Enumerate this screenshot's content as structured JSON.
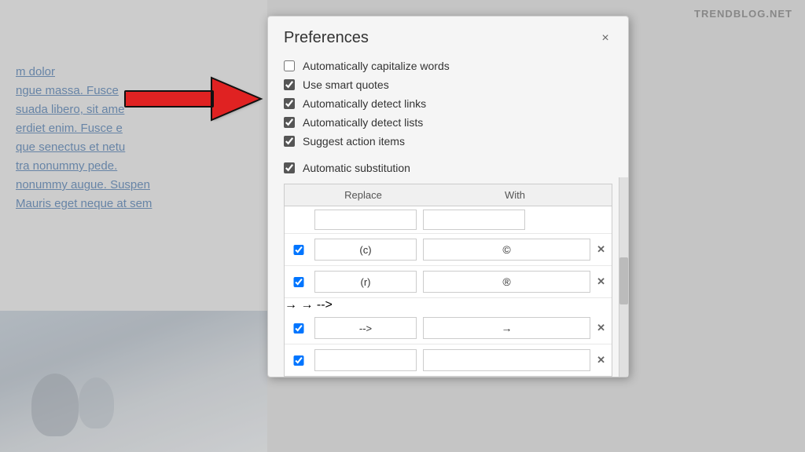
{
  "watermark": "TRENDBLOG.NET",
  "background": {
    "text_lines": [
      "m dolor",
      "ngue massa. Fusce",
      "suada libero, sit ame",
      "erdiet enim. Fusce e",
      "que senectus et netu",
      "tra nonummy pede.",
      "nonummy augue. Suspen",
      "Mauris eget neque at sem"
    ]
  },
  "dialog": {
    "title": "Preferences",
    "close_label": "×",
    "checkboxes": [
      {
        "id": "cap",
        "label": "Automatically capitalize words",
        "checked": false
      },
      {
        "id": "sq",
        "label": "Use smart quotes",
        "checked": true
      },
      {
        "id": "links",
        "label": "Automatically detect links",
        "checked": true
      },
      {
        "id": "lists",
        "label": "Automatically detect lists",
        "checked": true
      },
      {
        "id": "action",
        "label": "Suggest action items",
        "checked": true
      }
    ],
    "auto_sub_label": "Automatic substitution",
    "auto_sub_checked": true,
    "table": {
      "col_replace": "Replace",
      "col_with": "With",
      "rows": [
        {
          "replace": "(c)",
          "with": "©"
        },
        {
          "replace": "(r)",
          "with": "®"
        },
        {
          "replace": "-->",
          "with": "→"
        },
        {
          "replace": "",
          "with": ""
        }
      ]
    }
  }
}
